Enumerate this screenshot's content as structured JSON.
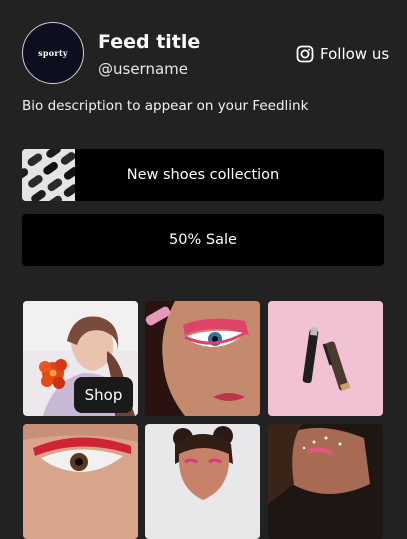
{
  "profile": {
    "avatar_text": "sporty",
    "title": "Feed title",
    "username": "@username",
    "bio": "Bio description to appear on your Feedlink",
    "follow_label": "Follow us",
    "follow_icon": "instagram-icon"
  },
  "links": [
    {
      "label": "New shoes collection",
      "thumbnail": "shoes-thumbnail"
    },
    {
      "label": "50% Sale"
    }
  ],
  "grid": {
    "shop_label": "Shop",
    "tiles": [
      "woman-with-red-flower",
      "red-eye-makeup-closeup",
      "mascara-on-pink",
      "red-eyeliner-closeup",
      "woman-with-hair-buns",
      "woman-with-sparkle-makeup"
    ]
  },
  "colors": {
    "background": "#222222",
    "button": "#000000",
    "text": "#ffffff"
  }
}
